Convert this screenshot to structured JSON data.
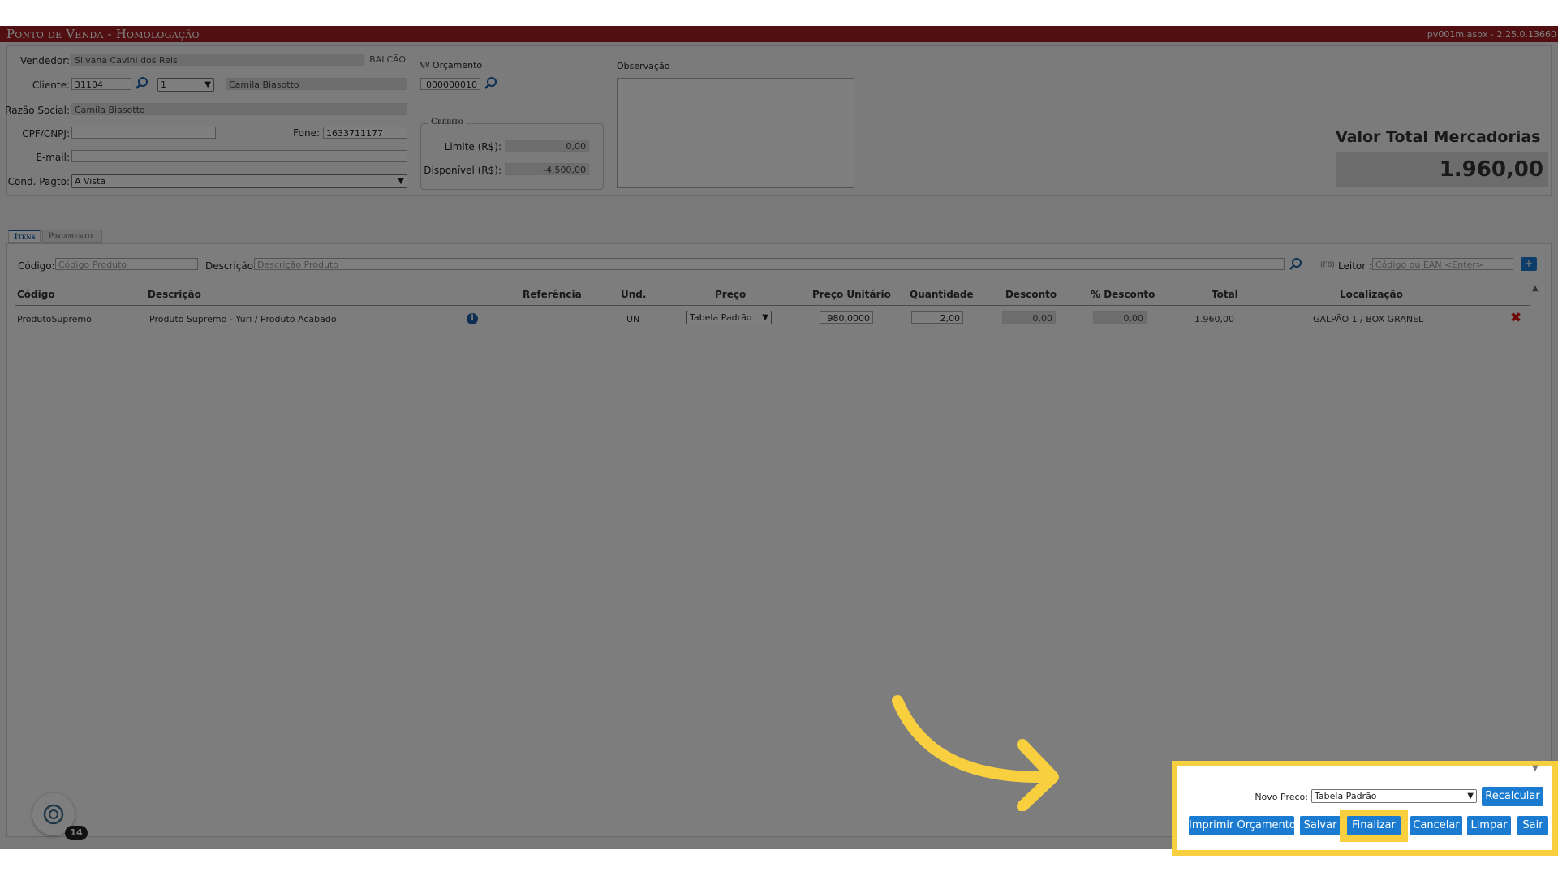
{
  "window": {
    "title": "Ponto de Venda  - Homologação",
    "version": "pv001m.aspx - 2.25.0.13660"
  },
  "header": {
    "vendedor_label": "Vendedor:",
    "vendedor_value": "Silvana Cavini dos Reis",
    "balcao": "BALCÃO",
    "cliente_label": "Cliente:",
    "cliente_code": "31104",
    "cliente_seq": "1",
    "cliente_name": "Camila Biasotto",
    "razao_label": "Razão Social:",
    "razao_value": "Camila Biasotto",
    "cpf_label": "CPF/CNPJ:",
    "cpf_value": "",
    "fone_label": "Fone:",
    "fone_value": "1633711177",
    "email_label": "E-mail:",
    "email_value": "",
    "cond_label": "Cond. Pagto:",
    "cond_value": "A Vista",
    "orcamento_label": "Nº Orçamento",
    "orcamento_value": "000000010",
    "credito_legend": "Crédito",
    "limite_label": "Limite (R$):",
    "limite_value": "0,00",
    "disponivel_label": "Disponível (R$):",
    "disponivel_value": "-4.500,00",
    "observacao_label": "Observação",
    "total_label": "Valor Total Mercadorias",
    "total_value": "1.960,00"
  },
  "tabs": [
    {
      "label": "Itens"
    },
    {
      "label": "Pagamento"
    }
  ],
  "search": {
    "codigo_label": "Código:",
    "codigo_placeholder": "Código Produto",
    "descricao_label": "Descrição:",
    "descricao_placeholder": "Descrição Produto",
    "f8": "(F8)",
    "leitor_label": "Leitor :",
    "leitor_placeholder": "Código ou EAN <Enter>",
    "add": "+"
  },
  "table": {
    "columns": [
      "Código",
      "Descrição",
      "Referência",
      "Und.",
      "Preço",
      "Preço Unitário",
      "Quantidade",
      "Desconto",
      "% Desconto",
      "Total",
      "Localização"
    ],
    "rows": [
      {
        "codigo": "ProdutoSupremo",
        "descricao": "Produto Supremo - Yuri / Produto Acabado",
        "referencia": "",
        "und": "UN",
        "preco": "Tabela Padrão",
        "preco_unitario": "980,0000",
        "quantidade": "2,00",
        "desconto": "0,00",
        "pct_desconto": "0,00",
        "total": "1.960,00",
        "localizacao": "GALPÃO 1 / BOX GRANEL"
      }
    ]
  },
  "footer": {
    "novo_preco_label": "Novo Preço:",
    "novo_preco_value": "Tabela Padrão",
    "recalcular": "Recalcular",
    "buttons": [
      "Imprimir Orçamento",
      "Salvar",
      "Finalizar",
      "Cancelar",
      "Limpar",
      "Sair"
    ]
  },
  "badge": {
    "count": "14"
  },
  "colors": {
    "titlebar": "#a21e24",
    "button": "#1a7bd1",
    "highlight": "#f8cf3e",
    "overlay": "rgba(0,0,0,0.5)"
  }
}
